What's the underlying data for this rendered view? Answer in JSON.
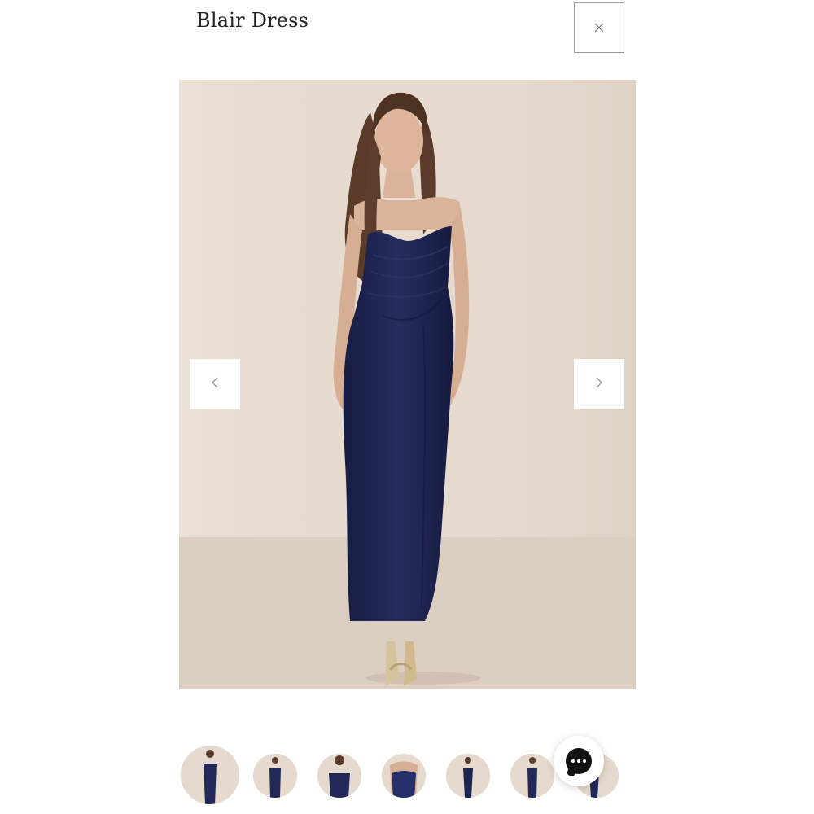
{
  "product": {
    "title": "Blair Dress"
  },
  "controls": {
    "close_icon": "close-icon",
    "prev_icon": "chevron-left-icon",
    "next_icon": "chevron-right-icon",
    "chat_icon": "chat-icon"
  },
  "gallery": {
    "thumbnail_count": 7,
    "active_index": 0
  },
  "colors": {
    "dress": "#1f2550",
    "backdrop": "#e6d9cd",
    "floor": "#dccdbf",
    "text": "#222222"
  }
}
